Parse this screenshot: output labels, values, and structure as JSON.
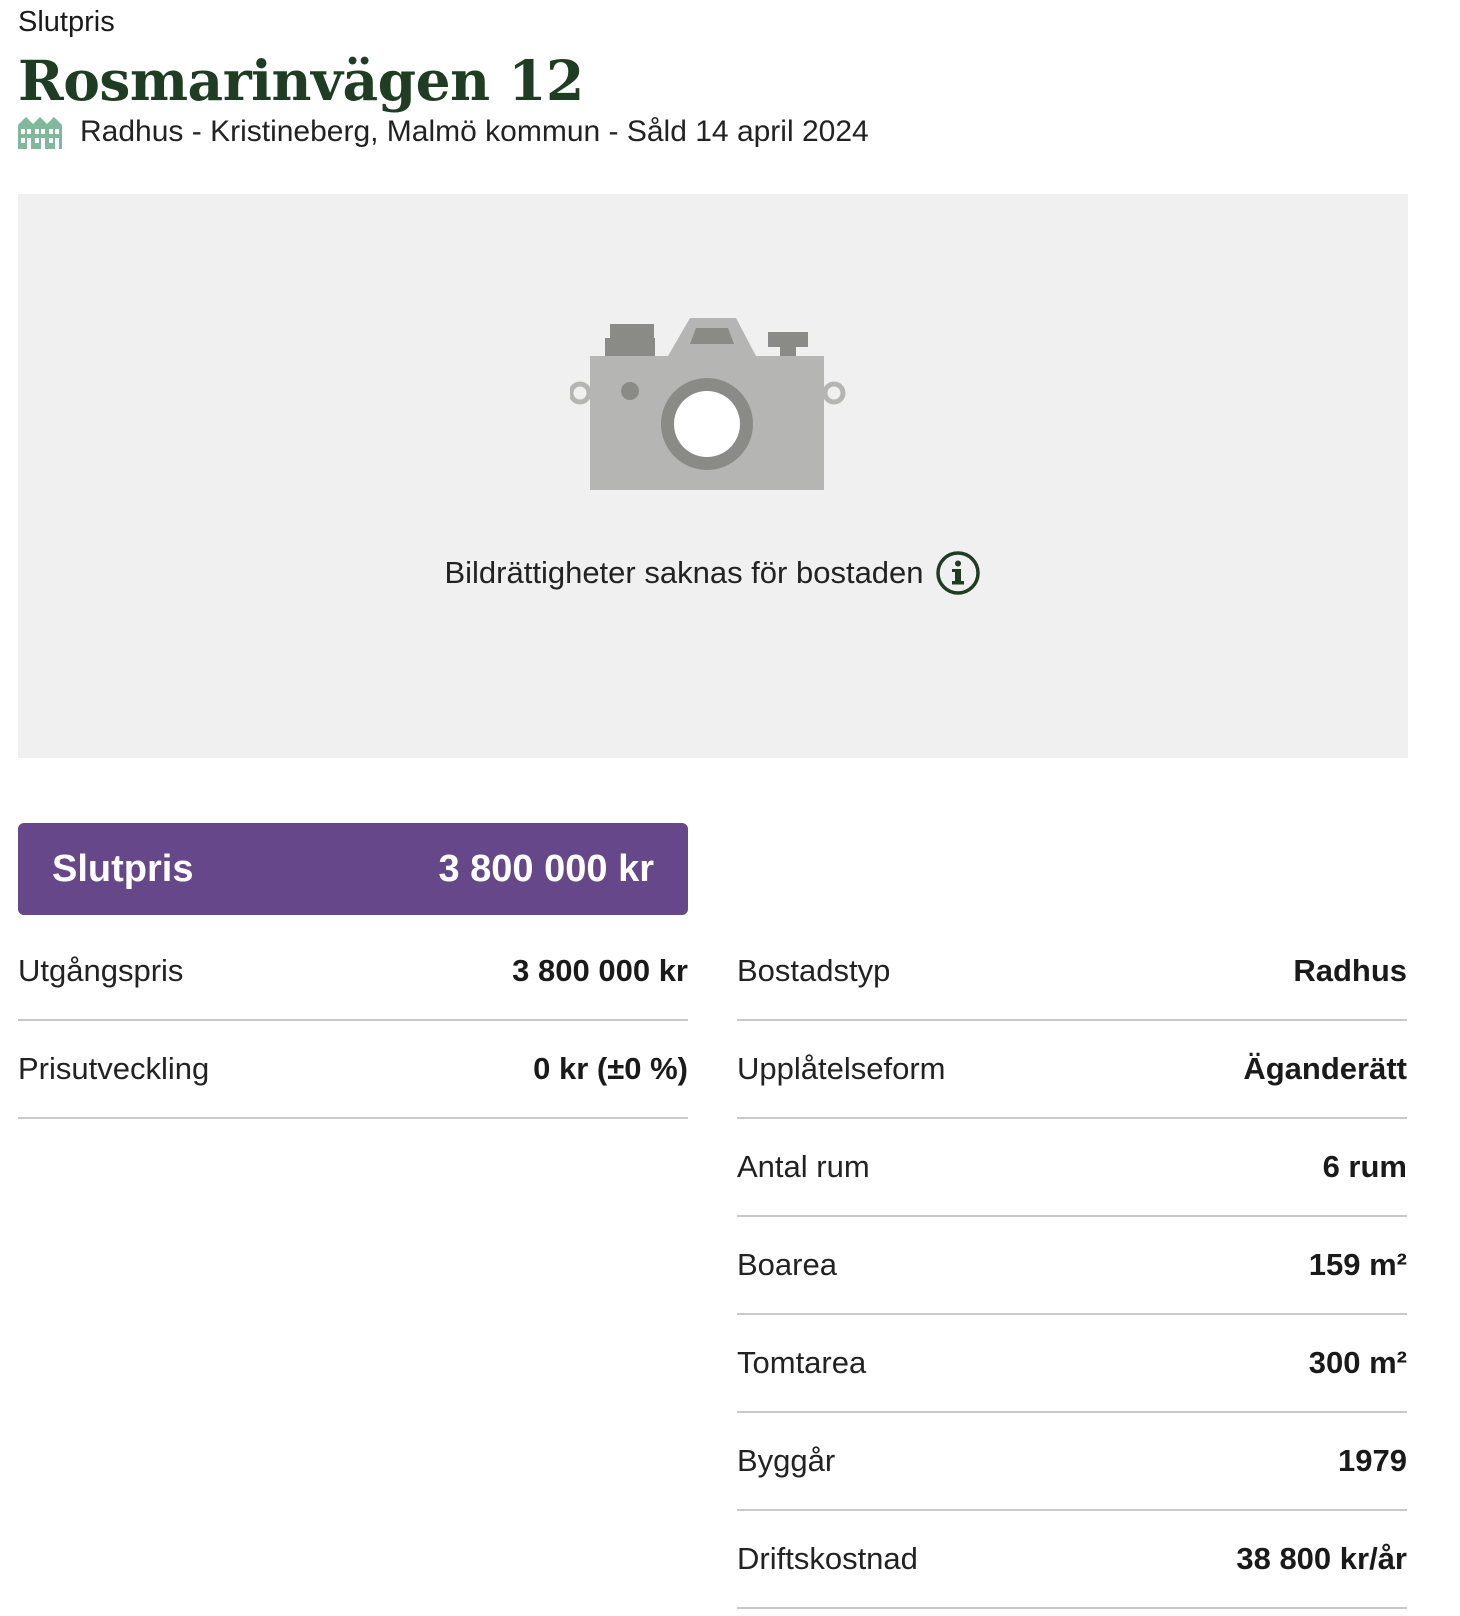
{
  "header": {
    "eyebrow": "Slutpris",
    "title": "Rosmarinvägen 12",
    "subtitle": "Radhus - Kristineberg, Malmö kommun - Såld 14 april 2024",
    "type_icon": "townhouse-icon"
  },
  "media": {
    "placeholder_icon": "camera-icon",
    "note": "Bildrättigheter saknas för bostaden",
    "note_icon": "info-icon",
    "background": "#f0f0f0"
  },
  "price": {
    "label": "Slutpris",
    "value": "3 800 000 kr",
    "color": "#65478a"
  },
  "facts_left": [
    {
      "label": "Utgångspris",
      "value": "3 800 000 kr"
    },
    {
      "label": "Prisutveckling",
      "value": "0 kr (±0 %)"
    }
  ],
  "facts_right": [
    {
      "label": "Bostadstyp",
      "value": "Radhus"
    },
    {
      "label": "Upplåtelseform",
      "value": "Äganderätt"
    },
    {
      "label": "Antal rum",
      "value": "6 rum"
    },
    {
      "label": "Boarea",
      "value": "159 m²"
    },
    {
      "label": "Tomtarea",
      "value": "300 m²"
    },
    {
      "label": "Byggår",
      "value": "1979"
    },
    {
      "label": "Driftskostnad",
      "value": "38 800 kr/år"
    }
  ],
  "colors": {
    "title": "#1e3d22",
    "icon_green": "#7fb89a"
  }
}
